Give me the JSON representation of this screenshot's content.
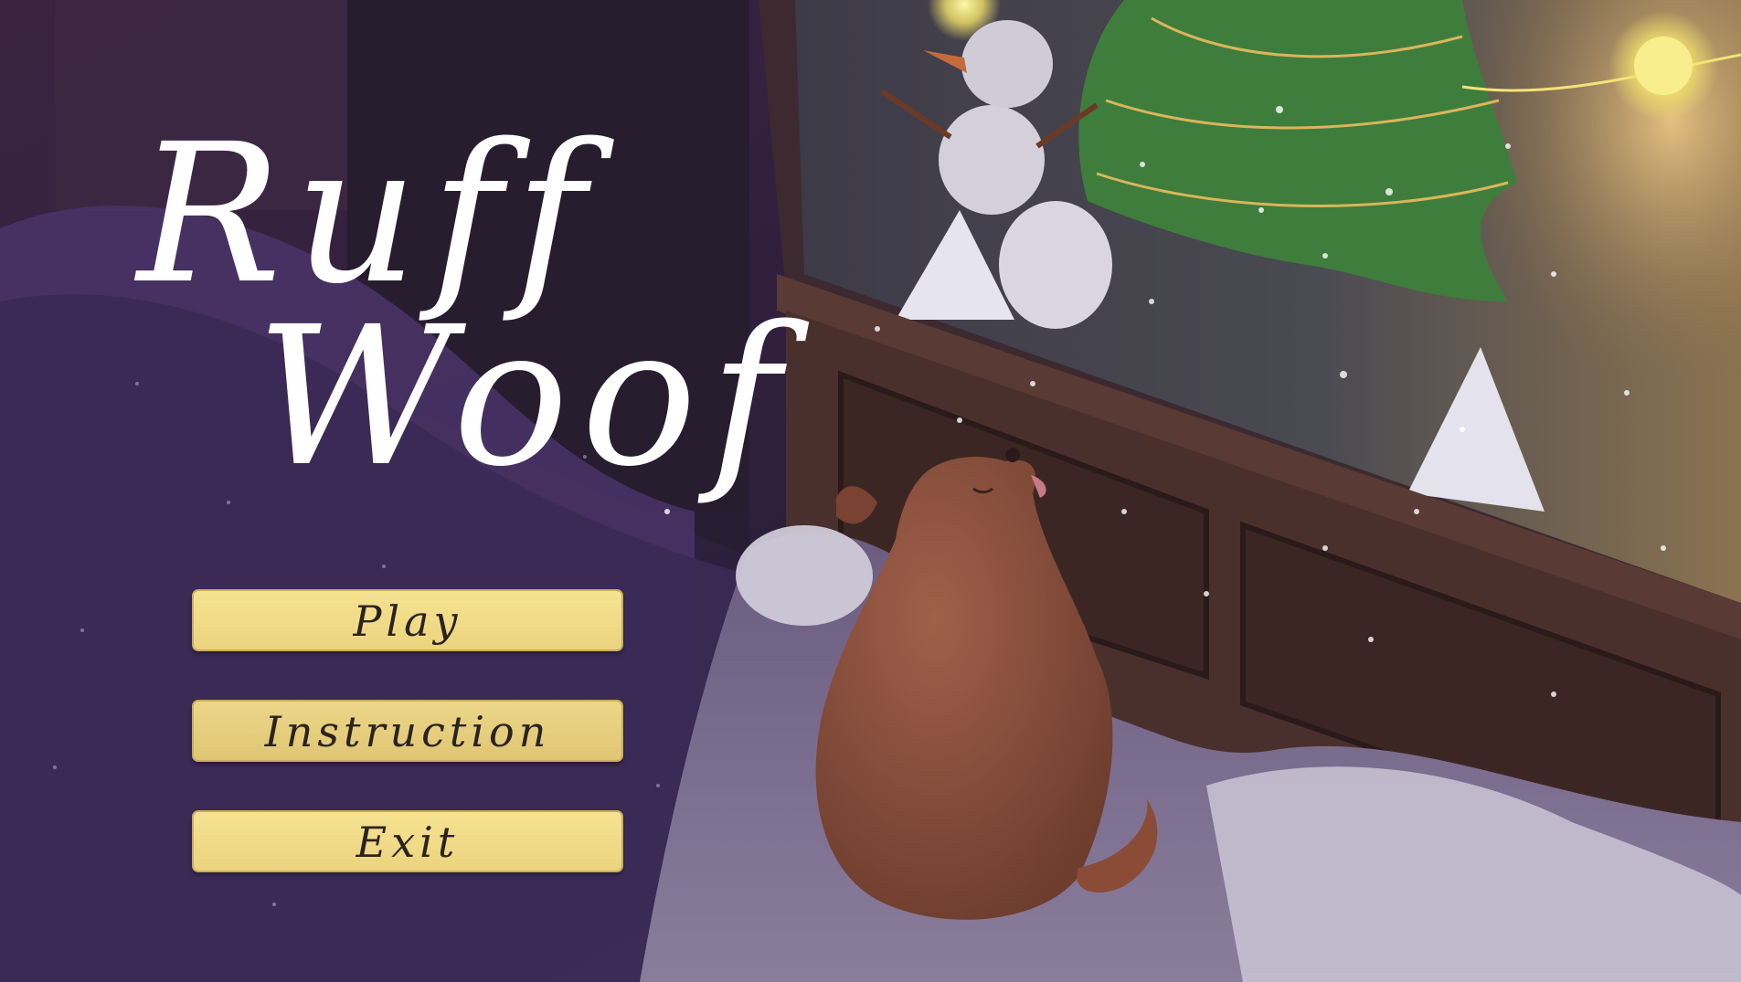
{
  "game": {
    "title_line1": "Ruff",
    "title_line2": "Woof"
  },
  "menu": {
    "items": [
      {
        "label": "Play"
      },
      {
        "label": "Instruction"
      },
      {
        "label": "Exit"
      }
    ]
  },
  "colors": {
    "button_fill": "#f1dc88",
    "button_text": "#2b2320",
    "title_text": "#ffffff",
    "night_sky": "#2a1d3a"
  }
}
